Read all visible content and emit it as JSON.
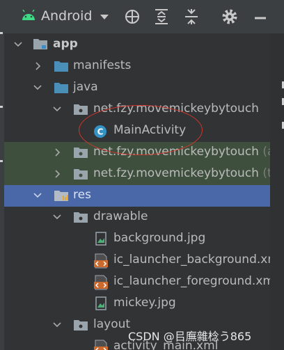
{
  "toolbar": {
    "view_name": "Android"
  },
  "tree": {
    "app": "app",
    "manifests": "manifests",
    "java": "java",
    "main_package": "net.fzy.movemickeybytouch",
    "main_activity": "MainActivity",
    "android_test_package": "net.fzy.movemickeybytouch",
    "android_test_suffix": "(and",
    "test_package": "net.fzy.movemickeybytouch",
    "test_suffix": "(tes",
    "res": "res",
    "drawable": "drawable",
    "background": "background.jpg",
    "ic_launcher_background": "ic_launcher_background.xml",
    "ic_launcher_foreground": "ic_launcher_foreground.xml",
    "mickey": "mickey.jpg",
    "layout": "layout",
    "activity_main": "activity_main.xml"
  },
  "watermark": "CSDN @㠯廡雜棯う865",
  "colors": {
    "selection": "#4a67a8",
    "test_highlight": "#3f4f3d",
    "annotation_ring": "#d9342b",
    "folder": "#4a8fb8",
    "xml_icon": "#cc6a2e"
  }
}
